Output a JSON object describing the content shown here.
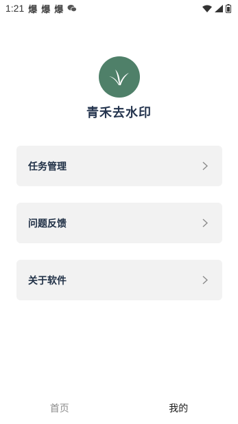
{
  "status_bar": {
    "time": "1:21",
    "notifications": [
      "爆",
      "爆",
      "爆"
    ],
    "icons": [
      "wechat-icon",
      "wifi-icon",
      "signal-icon",
      "battery-icon"
    ]
  },
  "app": {
    "name": "青禾去水印",
    "logo_icon": "sprout-icon",
    "logo_color": "#4f8069"
  },
  "menu": [
    {
      "label": "任务管理",
      "icon": "chevron-right-icon"
    },
    {
      "label": "问题反馈",
      "icon": "chevron-right-icon"
    },
    {
      "label": "关于软件",
      "icon": "chevron-right-icon"
    }
  ],
  "tabbar": {
    "tabs": [
      {
        "label": "首页",
        "active": false
      },
      {
        "label": "我的",
        "active": true
      }
    ]
  }
}
